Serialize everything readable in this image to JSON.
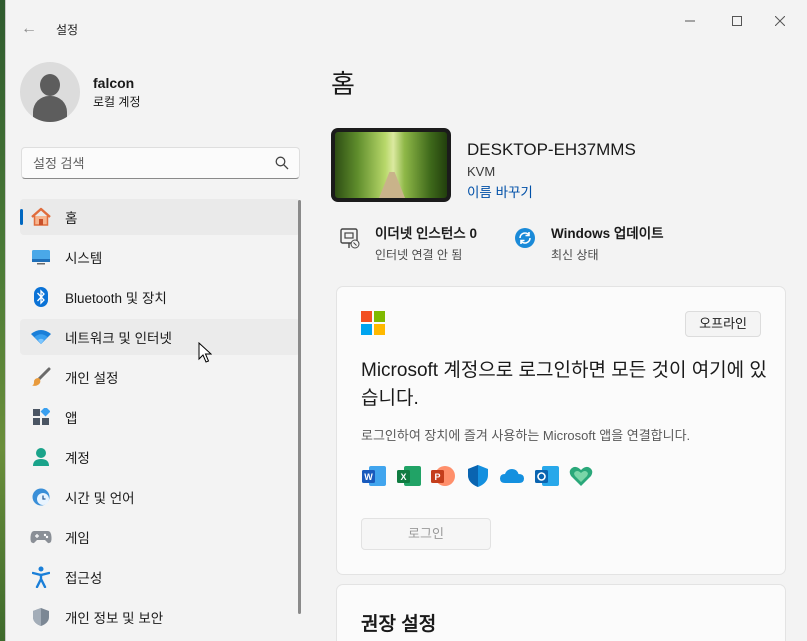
{
  "window": {
    "title": "설정",
    "back_icon": "back-arrow-icon"
  },
  "profile": {
    "name": "falcon",
    "account_type": "로컬 계정"
  },
  "search": {
    "placeholder": "설정 검색"
  },
  "sidebar": {
    "items": [
      {
        "label": "홈",
        "icon": "home-icon",
        "state": "active"
      },
      {
        "label": "시스템",
        "icon": "system-icon"
      },
      {
        "label": "Bluetooth 및 장치",
        "icon": "bluetooth-icon"
      },
      {
        "label": "네트워크 및 인터넷",
        "icon": "network-icon",
        "state": "hover"
      },
      {
        "label": "개인 설정",
        "icon": "brush-icon"
      },
      {
        "label": "앱",
        "icon": "apps-icon"
      },
      {
        "label": "계정",
        "icon": "account-icon"
      },
      {
        "label": "시간 및 언어",
        "icon": "time-language-icon"
      },
      {
        "label": "게임",
        "icon": "gamepad-icon"
      },
      {
        "label": "접근성",
        "icon": "accessibility-icon"
      },
      {
        "label": "개인 정보 및 보안",
        "icon": "shield-icon"
      }
    ]
  },
  "main": {
    "title": "홈",
    "device": {
      "name": "DESKTOP-EH37MMS",
      "model": "KVM",
      "rename_label": "이름 바꾸기"
    },
    "status": [
      {
        "title": "이더넷 인스턴스 0",
        "subtitle": "인터넷 연결 안 됨",
        "icon": "ethernet-icon"
      },
      {
        "title": "Windows 업데이트",
        "subtitle": "최신 상태",
        "icon": "update-icon"
      }
    ],
    "ms_card": {
      "offline_label": "오프라인",
      "heading": "Microsoft 계정으로 로그인하면 모든 것이 여기에 있습니다.",
      "description": "로그인하여 장치에 즐겨 사용하는 Microsoft 앱을 연결합니다.",
      "apps": [
        "word-icon",
        "excel-icon",
        "powerpoint-icon",
        "defender-icon",
        "onedrive-icon",
        "outlook-icon",
        "family-icon"
      ],
      "login_label": "로그인"
    },
    "recommended_title": "권장 설정"
  },
  "colors": {
    "accent": "#0067c0",
    "link": "#0050a8"
  }
}
